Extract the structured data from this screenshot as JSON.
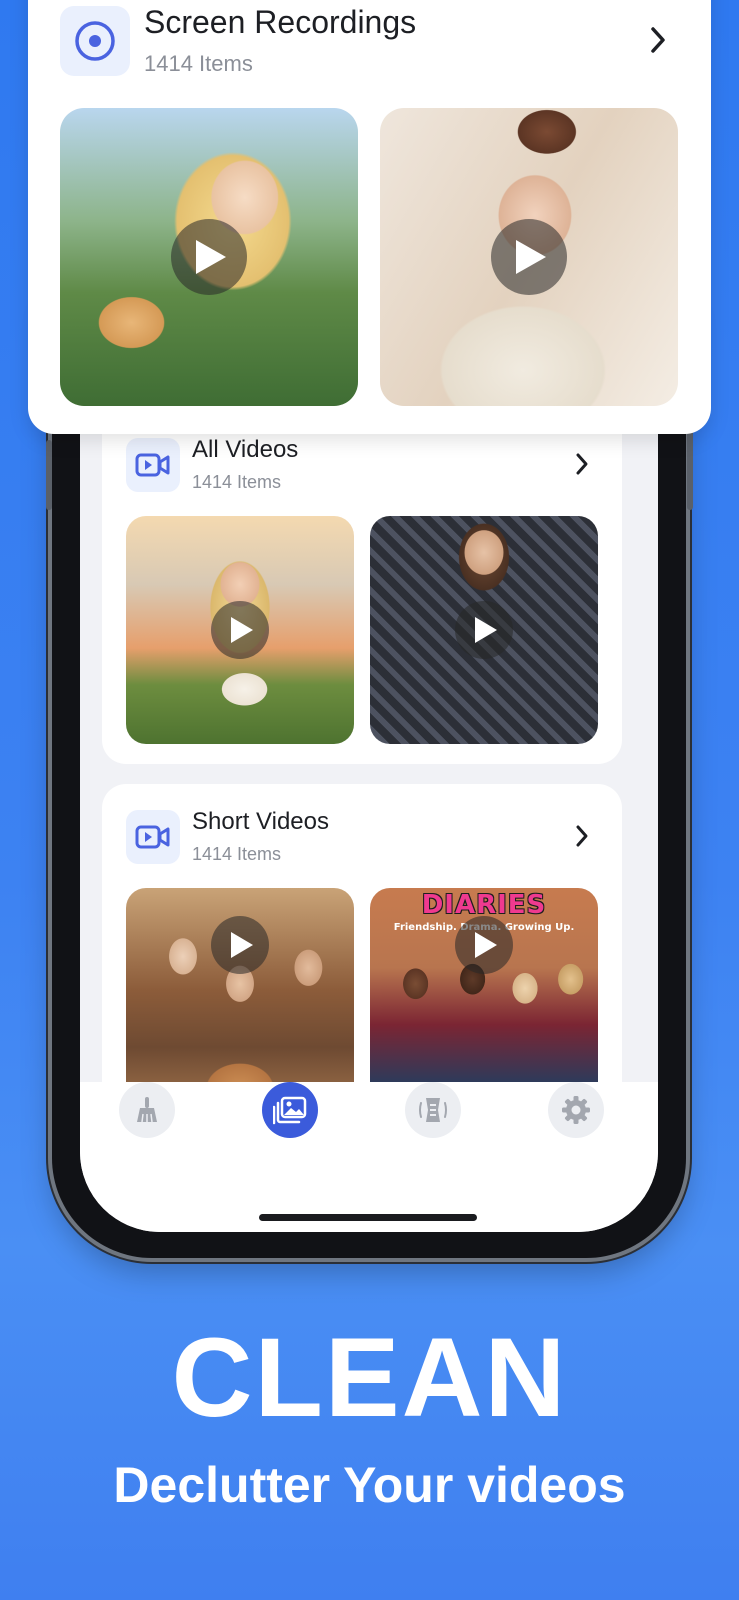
{
  "albums": [
    {
      "title": "Screen Recordings",
      "count": "1414 Items",
      "icon": "screen-record-icon"
    },
    {
      "title": "All Videos",
      "count": "1414 Items",
      "icon": "video-camera-icon"
    },
    {
      "title": "Short Videos",
      "count": "1414 Items",
      "icon": "video-camera-icon"
    }
  ],
  "thumb_text": {
    "title": "DIARIES",
    "subtitle": "Friendship. Drama. Growing Up."
  },
  "tabs": [
    {
      "name": "clean-tab",
      "icon": "broom-icon",
      "active": false
    },
    {
      "name": "media-tab",
      "icon": "photo-stack-icon",
      "active": true
    },
    {
      "name": "compress-tab",
      "icon": "compress-icon",
      "active": false
    },
    {
      "name": "settings-tab",
      "icon": "gear-icon",
      "active": false
    }
  ],
  "marketing": {
    "headline": "CLEAN",
    "subline": "Declutter Your videos"
  },
  "colors": {
    "background": "#3b80f1",
    "accent": "#3b5bdb",
    "icon_tint": "#4a63e0",
    "card": "#ffffff"
  }
}
